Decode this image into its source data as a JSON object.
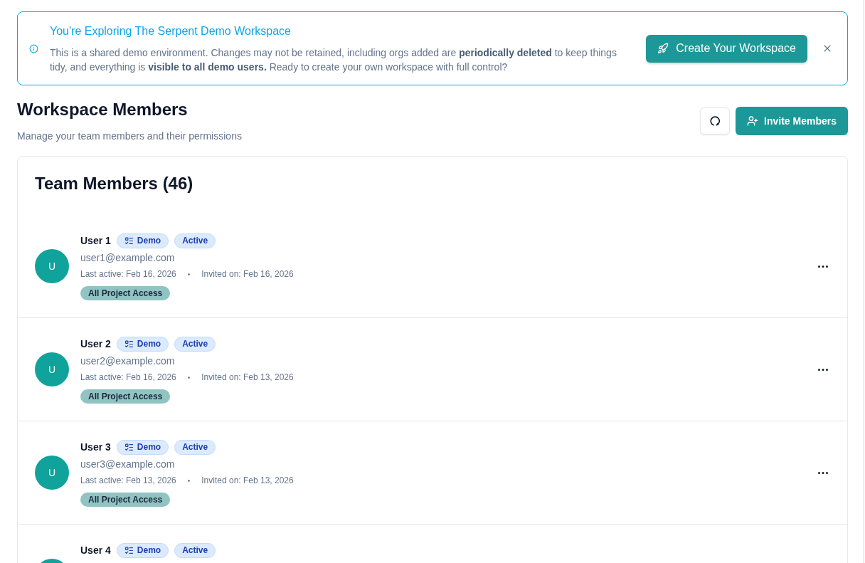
{
  "banner": {
    "title": "You're Exploring The Serpent Demo Workspace",
    "message": "This is a shared demo environment. Changes may not be retained, including orgs added are **periodically deleted** to keep things tidy, and everything is **visible to all demo users.** Ready to create your own workspace with full control?",
    "action": "Create Your Workspace"
  },
  "header": {
    "title": "Workspace Members",
    "subtitle": "Manage your team members and their permissions",
    "invite": "Invite Members"
  },
  "members_card": {
    "title": "Team Members (46)",
    "members": [
      {
        "name": "User 1",
        "tags": [
          {
            "kind": "demo",
            "label": "Demo"
          },
          {
            "kind": "status",
            "label": "Active"
          }
        ],
        "avatar_initial": "U",
        "email": "user1@example.com",
        "last_active": "Last active: Feb 16, 2026",
        "separator": "•",
        "invited": "Invited on: Feb 16, 2026",
        "access": "All Project Access"
      },
      {
        "name": "User 2",
        "tags": [
          {
            "kind": "demo",
            "label": "Demo"
          },
          {
            "kind": "status",
            "label": "Active"
          }
        ],
        "avatar_initial": "U",
        "email": "user2@example.com",
        "last_active": "Last active: Feb 16, 2026",
        "separator": "•",
        "invited": "Invited on: Feb 13, 2026",
        "access": "All Project Access"
      },
      {
        "name": "User 3",
        "tags": [
          {
            "kind": "demo",
            "label": "Demo"
          },
          {
            "kind": "status",
            "label": "Active"
          }
        ],
        "avatar_initial": "U",
        "email": "user3@example.com",
        "last_active": "Last active: Feb 13, 2026",
        "separator": "•",
        "invited": "Invited on: Feb 13, 2026",
        "access": "All Project Access"
      },
      {
        "name": "User 4",
        "tags": [
          {
            "kind": "demo",
            "label": "Demo"
          },
          {
            "kind": "status",
            "label": "Active"
          }
        ]
      }
    ]
  }
}
